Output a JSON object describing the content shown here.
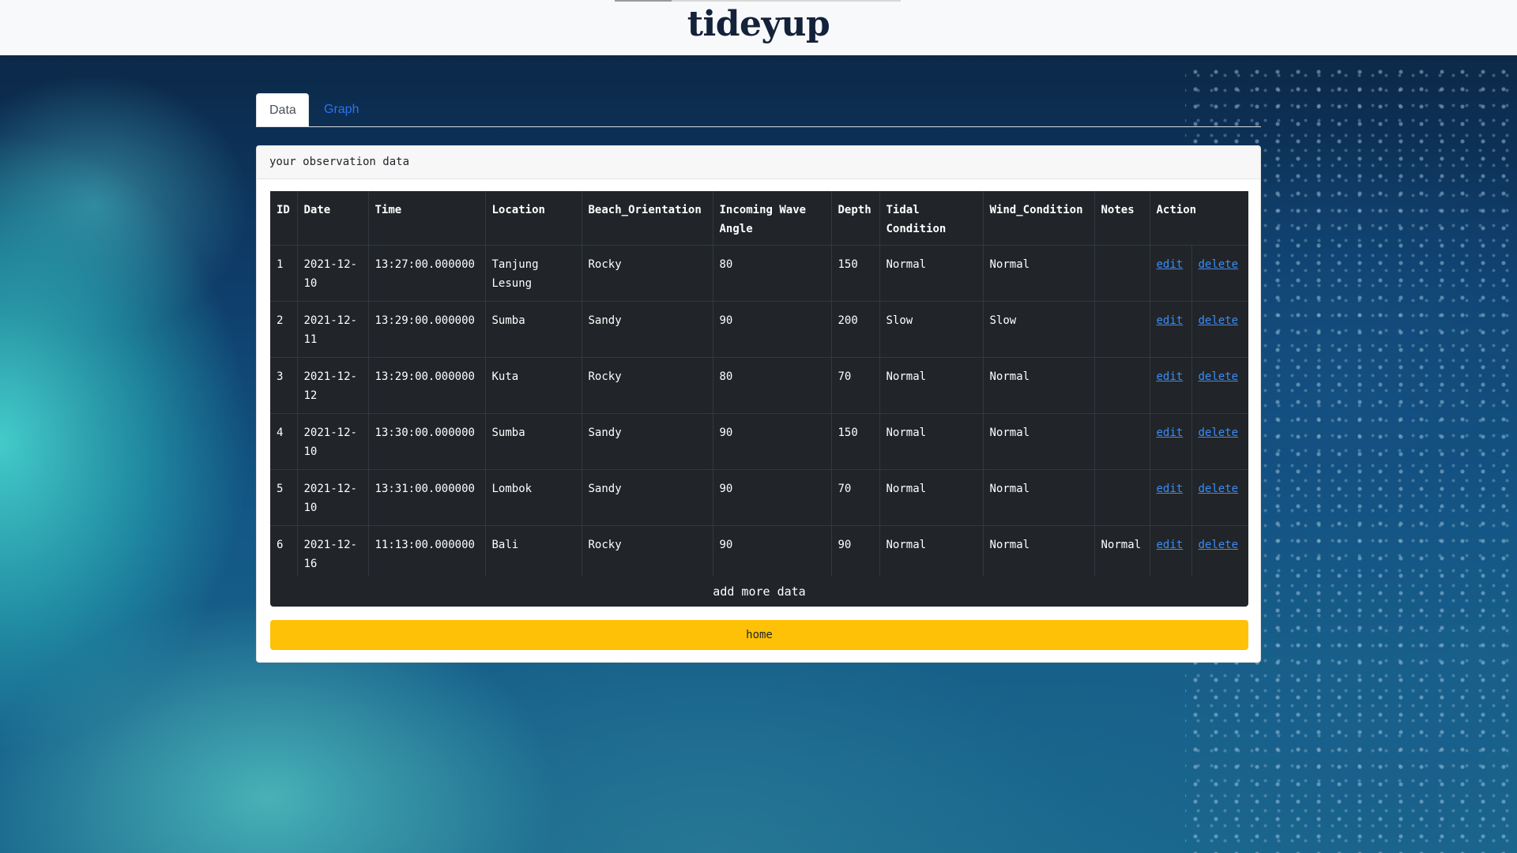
{
  "header": {
    "brand": "tideyup",
    "progress": 0.2
  },
  "tabs": [
    {
      "label": "Data",
      "active": true
    },
    {
      "label": "Graph",
      "active": false
    }
  ],
  "card": {
    "title": "your observation data"
  },
  "table": {
    "columns": [
      "ID",
      "Date",
      "Time",
      "Location",
      "Beach_Orientation",
      "Incoming Wave Angle",
      "Depth",
      "Tidal Condition",
      "Wind_Condition",
      "Notes",
      "Action"
    ],
    "rows": [
      {
        "id": "1",
        "date": "2021-12-10",
        "time": "13:27:00.000000",
        "location": "Tanjung Lesung",
        "orientation": "Rocky",
        "angle": "80",
        "depth": "150",
        "tidal": "Normal",
        "wind": "Normal",
        "notes": "",
        "edit": "edit",
        "delete": "delete"
      },
      {
        "id": "2",
        "date": "2021-12-11",
        "time": "13:29:00.000000",
        "location": "Sumba",
        "orientation": "Sandy",
        "angle": "90",
        "depth": "200",
        "tidal": "Slow",
        "wind": "Slow",
        "notes": "",
        "edit": "edit",
        "delete": "delete"
      },
      {
        "id": "3",
        "date": "2021-12-12",
        "time": "13:29:00.000000",
        "location": "Kuta",
        "orientation": "Rocky",
        "angle": "80",
        "depth": "70",
        "tidal": "Normal",
        "wind": "Normal",
        "notes": "",
        "edit": "edit",
        "delete": "delete"
      },
      {
        "id": "4",
        "date": "2021-12-10",
        "time": "13:30:00.000000",
        "location": "Sumba",
        "orientation": "Sandy",
        "angle": "90",
        "depth": "150",
        "tidal": "Normal",
        "wind": "Normal",
        "notes": "",
        "edit": "edit",
        "delete": "delete"
      },
      {
        "id": "5",
        "date": "2021-12-10",
        "time": "13:31:00.000000",
        "location": "Lombok",
        "orientation": "Sandy",
        "angle": "90",
        "depth": "70",
        "tidal": "Normal",
        "wind": "Normal",
        "notes": "",
        "edit": "edit",
        "delete": "delete"
      },
      {
        "id": "6",
        "date": "2021-12-16",
        "time": "11:13:00.000000",
        "location": "Bali",
        "orientation": "Rocky",
        "angle": "90",
        "depth": "90",
        "tidal": "Normal",
        "wind": "Normal",
        "notes": "Normal",
        "edit": "edit",
        "delete": "delete"
      }
    ]
  },
  "buttons": {
    "add": "add more data",
    "home": "home"
  },
  "colors": {
    "table_bg": "#212529",
    "link": "#3b8cf5",
    "home_button": "#ffc107",
    "tab_link": "#2a72f0"
  }
}
